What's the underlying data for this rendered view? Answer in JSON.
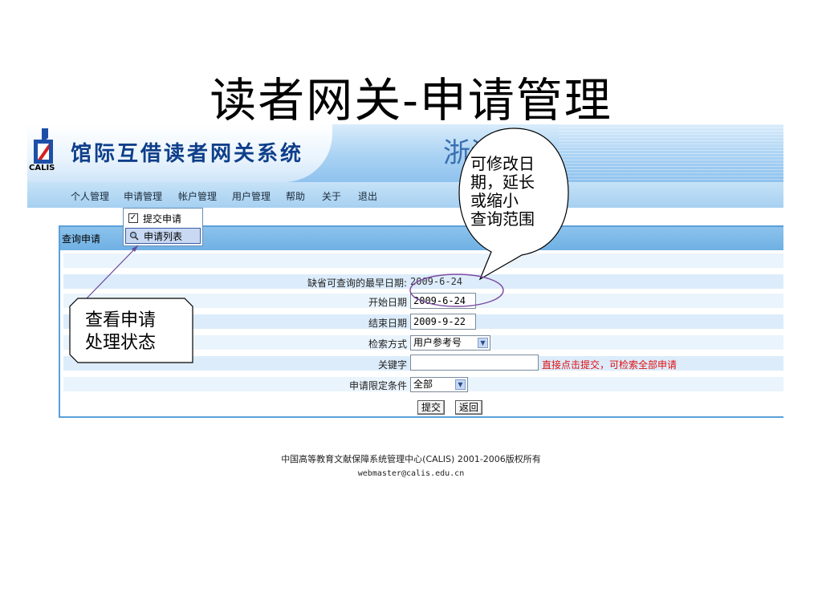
{
  "slide": {
    "title": "读者网关-申请管理"
  },
  "banner": {
    "logo_text": "CALIS",
    "system_title": "馆际互借读者网关系统",
    "school_name": "浙江大学"
  },
  "nav": {
    "items": [
      {
        "label": "个人管理"
      },
      {
        "label": "申请管理"
      },
      {
        "label": "帐户管理"
      },
      {
        "label": "用户管理"
      },
      {
        "label": "帮助"
      },
      {
        "label": "关于"
      },
      {
        "label": "退出"
      }
    ]
  },
  "dropdown": {
    "items": [
      {
        "label": "提交申请",
        "icon": "checkbox-icon"
      },
      {
        "label": "申请列表",
        "icon": "magnifier-icon"
      }
    ]
  },
  "panel": {
    "title": "查询申请",
    "earliest_label": "缺省可查询的最早日期:",
    "earliest_value": "2009-6-24",
    "start_label": "开始日期",
    "start_value": "2009-6-24",
    "end_label": "结束日期",
    "end_value": "2009-9-22",
    "search_mode_label": "检索方式",
    "search_mode_value": "用户参考号",
    "keyword_label": "关键字",
    "keyword_value": "",
    "keyword_hint": "直接点击提交，可检索全部申请",
    "condition_label": "申请限定条件",
    "condition_value": "全部",
    "submit_label": "提交",
    "back_label": "返回"
  },
  "footer": {
    "copyright": "中国高等教育文献保障系统管理中心(CALIS) 2001-2006版权所有",
    "email": "webmaster@calis.edu.cn"
  },
  "callouts": {
    "date_note_lines": [
      "可修改日",
      "期，延长",
      "或缩小",
      "查询范围"
    ],
    "status_note_lines": [
      "查看申请",
      "处理状态"
    ]
  },
  "colors": {
    "banner_blue": "#8fc2ee",
    "title_blue": "#0f3f8a",
    "hint_red": "#e01010",
    "panel_border": "#5aa0d8",
    "ellipse": "#7a4aa0"
  }
}
